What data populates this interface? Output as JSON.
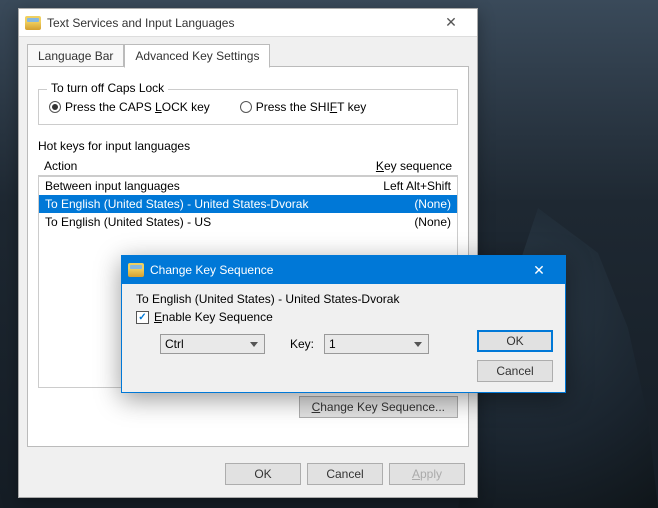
{
  "window": {
    "title": "Text Services and Input Languages",
    "tabs": {
      "language_bar": "Language Bar",
      "advanced_key": "Advanced Key Settings"
    },
    "caps_group": {
      "label": "To turn off Caps Lock",
      "radio_caps_pre": "Press the CAPS ",
      "radio_caps_u": "L",
      "radio_caps_post": "OCK key",
      "radio_shift_pre": "Press the SHI",
      "radio_shift_u": "F",
      "radio_shift_post": "T key"
    },
    "hotkeys": {
      "label": "Hot keys for input languages",
      "col_action": "Action",
      "col_key_u": "K",
      "col_key_post": "ey sequence",
      "rows": [
        {
          "action": "Between input languages",
          "key": "Left Alt+Shift"
        },
        {
          "action": "To English (United States) - United States-Dvorak",
          "key": "(None)"
        },
        {
          "action": "To English (United States) - US",
          "key": "(None)"
        }
      ],
      "change_btn_u": "C",
      "change_btn_post": "hange Key Sequence..."
    },
    "buttons": {
      "ok": "OK",
      "cancel": "Cancel",
      "apply_u": "A",
      "apply_post": "pply"
    }
  },
  "modal": {
    "title": "Change Key Sequence",
    "target": "To English (United States) - United States-Dvorak",
    "enable_u": "E",
    "enable_post": "nable Key Sequence",
    "modifier_value": "Ctrl",
    "key_label": "Key:",
    "key_value": "1",
    "ok": "OK",
    "cancel": "Cancel"
  }
}
